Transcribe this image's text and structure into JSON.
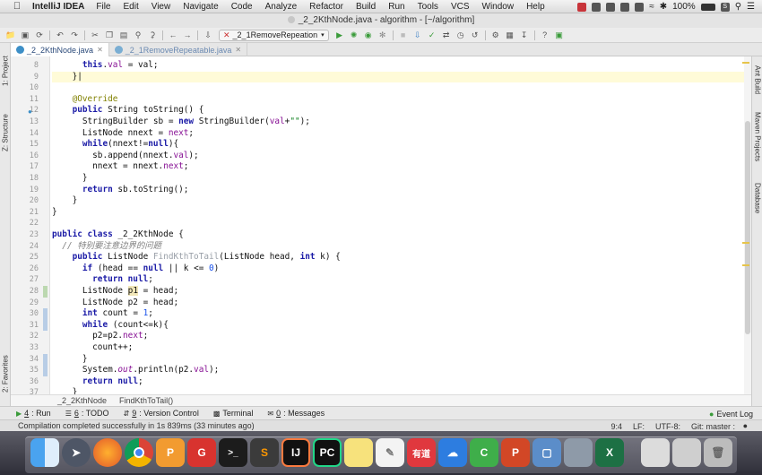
{
  "menubar": {
    "app_name": "IntelliJ IDEA",
    "items": [
      "File",
      "Edit",
      "View",
      "Navigate",
      "Code",
      "Analyze",
      "Refactor",
      "Build",
      "Run",
      "Tools",
      "VCS",
      "Window",
      "Help"
    ],
    "battery": "100%",
    "input_method_label": "S"
  },
  "window": {
    "title": "_2_2KthNode.java - algorithm - [~/algorithm]"
  },
  "toolbar": {
    "run_config": "_2_1RemoveRepeation"
  },
  "tabs": [
    {
      "label": "_2_2KthNode.java",
      "active": true
    },
    {
      "label": "_2_1RemoveRepeatable.java",
      "active": false
    }
  ],
  "left_tools": [
    "1: Project",
    "Z: Structure",
    "2: Favorites"
  ],
  "right_tools": [
    "Ant Build",
    "Maven Projects",
    "Database"
  ],
  "editor": {
    "line_numbers": [
      "8",
      "9",
      "10",
      "11",
      "12",
      "13",
      "14",
      "15",
      "16",
      "17",
      "18",
      "19",
      "20",
      "21",
      "22",
      "23",
      "24",
      "25",
      "26",
      "27",
      "28",
      "29",
      "30",
      "31",
      "32",
      "33",
      "34",
      "35",
      "36",
      "37"
    ],
    "current_line": "9"
  },
  "breadcrumb": [
    "_2_2KthNode",
    "FindKthToTail()"
  ],
  "bottom_tools": [
    {
      "key": "4",
      "label": ": Run",
      "icon": "play-icon"
    },
    {
      "key": "6",
      "label": ": TODO",
      "icon": "todo-icon"
    },
    {
      "key": "9",
      "label": ": Version Control",
      "icon": "vcs-icon"
    },
    {
      "key": "",
      "label": "Terminal",
      "icon": "terminal-icon"
    },
    {
      "key": "0",
      "label": ": Messages",
      "icon": "messages-icon"
    }
  ],
  "event_log": "Event Log",
  "status": {
    "message": "Compilation completed successfully in 1s 839ms (33 minutes ago)",
    "position": "9:4",
    "line_sep": "LF:",
    "encoding": "UTF-8:",
    "git": "Git: master :"
  },
  "dock_icons": [
    "finder",
    "launchpad",
    "firefox",
    "chrome",
    "pdf-reader",
    "wps",
    "terminal",
    "sublime-text",
    "intellij-idea",
    "pycharm",
    "notes",
    "text-edit",
    "youdao",
    "onedrive",
    "camtasia",
    "powerpoint",
    "preview",
    "excel",
    "documents",
    "stack",
    "trash"
  ]
}
